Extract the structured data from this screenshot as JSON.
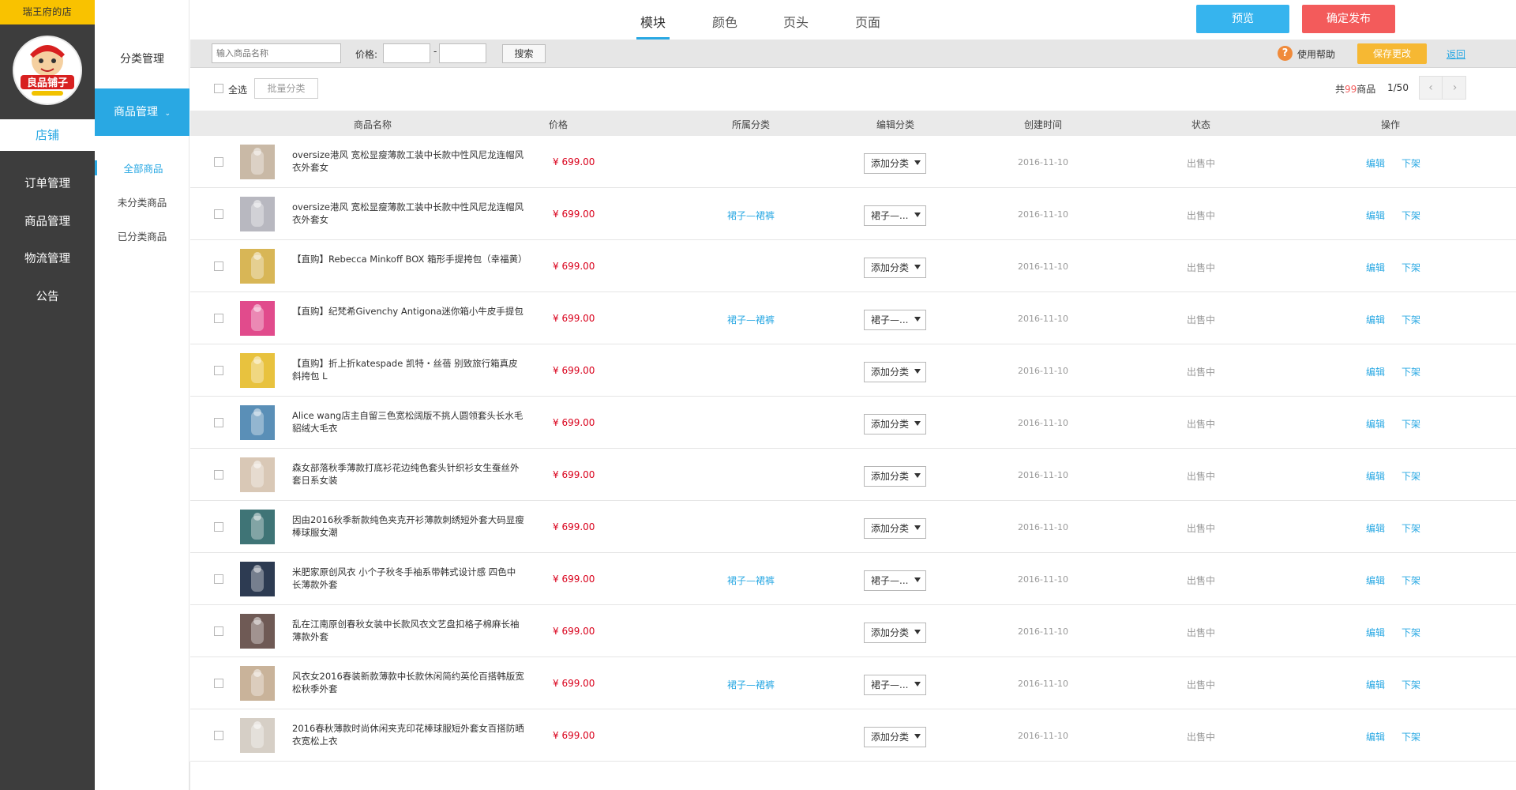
{
  "shop": {
    "name": "瑞王府的店",
    "logo_text": "良品铺子",
    "store_tab": "店铺"
  },
  "sidebar": {
    "items": [
      {
        "label": "订单管理"
      },
      {
        "label": "商品管理"
      },
      {
        "label": "物流管理"
      },
      {
        "label": "公告"
      }
    ]
  },
  "subnav": {
    "category_mgmt": "分类管理",
    "goods_mgmt": "商品管理",
    "items": [
      {
        "label": "全部商品"
      },
      {
        "label": "未分类商品"
      },
      {
        "label": "已分类商品"
      }
    ]
  },
  "topnav": {
    "tabs": [
      {
        "label": "模块"
      },
      {
        "label": "颜色"
      },
      {
        "label": "页头"
      },
      {
        "label": "页面"
      }
    ],
    "preview": "预览",
    "publish": "确定发布"
  },
  "filter": {
    "search_placeholder": "输入商品名称",
    "price_label": "价格:",
    "price_sep": "-",
    "search_btn": "搜索",
    "help": "使用帮助",
    "help_icon": "?",
    "save": "保存更改",
    "back": "返回"
  },
  "toolbar": {
    "select_all": "全选",
    "batch": "批量分类",
    "total_prefix": "共",
    "total_num": "99",
    "total_suffix": "商品",
    "page": "1/50",
    "prev_icon": "‹",
    "next_icon": "›"
  },
  "table": {
    "headers": {
      "name": "商品名称",
      "price": "价格",
      "category": "所属分类",
      "edit_category": "编辑分类",
      "created": "创建时间",
      "status": "状态",
      "action": "操作"
    },
    "rows": [
      {
        "name": "oversize港风 宽松显瘦薄款工装中长款中性风尼龙连帽风衣外套女",
        "price": "¥ 699.00",
        "category": "",
        "select": "添加分类",
        "date": "2016-11-10",
        "status": "出售中",
        "edit": "编辑",
        "off": "下架",
        "thumb": "#c9b9a6"
      },
      {
        "name": "oversize港风 宽松显瘦薄款工装中长款中性风尼龙连帽风衣外套女",
        "price": "¥ 699.00",
        "category": "裙子—裙裤",
        "select": "裙子—...",
        "date": "2016-11-10",
        "status": "出售中",
        "edit": "编辑",
        "off": "下架",
        "thumb": "#b8b8c0"
      },
      {
        "name": "【直购】Rebecca Minkoff BOX 箱形手提挎包（幸福黄）",
        "price": "¥ 699.00",
        "category": "",
        "select": "添加分类",
        "date": "2016-11-10",
        "status": "出售中",
        "edit": "编辑",
        "off": "下架",
        "thumb": "#d8b656"
      },
      {
        "name": "【直购】纪梵希Givenchy Antigona迷你箱小牛皮手提包",
        "price": "¥ 699.00",
        "category": "裙子—裙裤",
        "select": "裙子—...",
        "date": "2016-11-10",
        "status": "出售中",
        "edit": "编辑",
        "off": "下架",
        "thumb": "#e14b8c"
      },
      {
        "name": "【直购】折上折katespade 凯特・丝蓓 别致旅行箱真皮斜挎包 L",
        "price": "¥ 699.00",
        "category": "",
        "select": "添加分类",
        "date": "2016-11-10",
        "status": "出售中",
        "edit": "编辑",
        "off": "下架",
        "thumb": "#e8c23e"
      },
      {
        "name": "Alice wang店主自留三色宽松阔版不挑人圆领套头长水毛貂绒大毛衣",
        "price": "¥ 699.00",
        "category": "",
        "select": "添加分类",
        "date": "2016-11-10",
        "status": "出售中",
        "edit": "编辑",
        "off": "下架",
        "thumb": "#5a8fb7"
      },
      {
        "name": "森女部落秋季薄款打底衫花边纯色套头针织衫女生蚕丝外套日系女装",
        "price": "¥ 699.00",
        "category": "",
        "select": "添加分类",
        "date": "2016-11-10",
        "status": "出售中",
        "edit": "编辑",
        "off": "下架",
        "thumb": "#d9c8b6"
      },
      {
        "name": "因由2016秋季新款纯色夹克开衫薄款刺绣短外套大码显瘦棒球服女潮",
        "price": "¥ 699.00",
        "category": "",
        "select": "添加分类",
        "date": "2016-11-10",
        "status": "出售中",
        "edit": "编辑",
        "off": "下架",
        "thumb": "#3f7476"
      },
      {
        "name": "米肥家原创风衣 小个子秋冬手袖系带韩式设计感 四色中长薄款外套",
        "price": "¥ 699.00",
        "category": "裙子—裙裤",
        "select": "裙子—...",
        "date": "2016-11-10",
        "status": "出售中",
        "edit": "编辑",
        "off": "下架",
        "thumb": "#2d3b52"
      },
      {
        "name": "乱在江南原创春秋女装中长款风衣文艺盘扣格子棉麻长袖薄款外套",
        "price": "¥ 699.00",
        "category": "",
        "select": "添加分类",
        "date": "2016-11-10",
        "status": "出售中",
        "edit": "编辑",
        "off": "下架",
        "thumb": "#6f5a55"
      },
      {
        "name": "风衣女2016春装新款薄款中长款休闲简约英伦百搭韩版宽松秋季外套",
        "price": "¥ 699.00",
        "category": "裙子—裙裤",
        "select": "裙子—...",
        "date": "2016-11-10",
        "status": "出售中",
        "edit": "编辑",
        "off": "下架",
        "thumb": "#c9b39a"
      },
      {
        "name": "2016春秋薄款时尚休闲夹克印花棒球服短外套女百搭防晒衣宽松上衣",
        "price": "¥ 699.00",
        "category": "",
        "select": "添加分类",
        "date": "2016-11-10",
        "status": "出售中",
        "edit": "编辑",
        "off": "下架",
        "thumb": "#d6cfc6"
      }
    ]
  }
}
